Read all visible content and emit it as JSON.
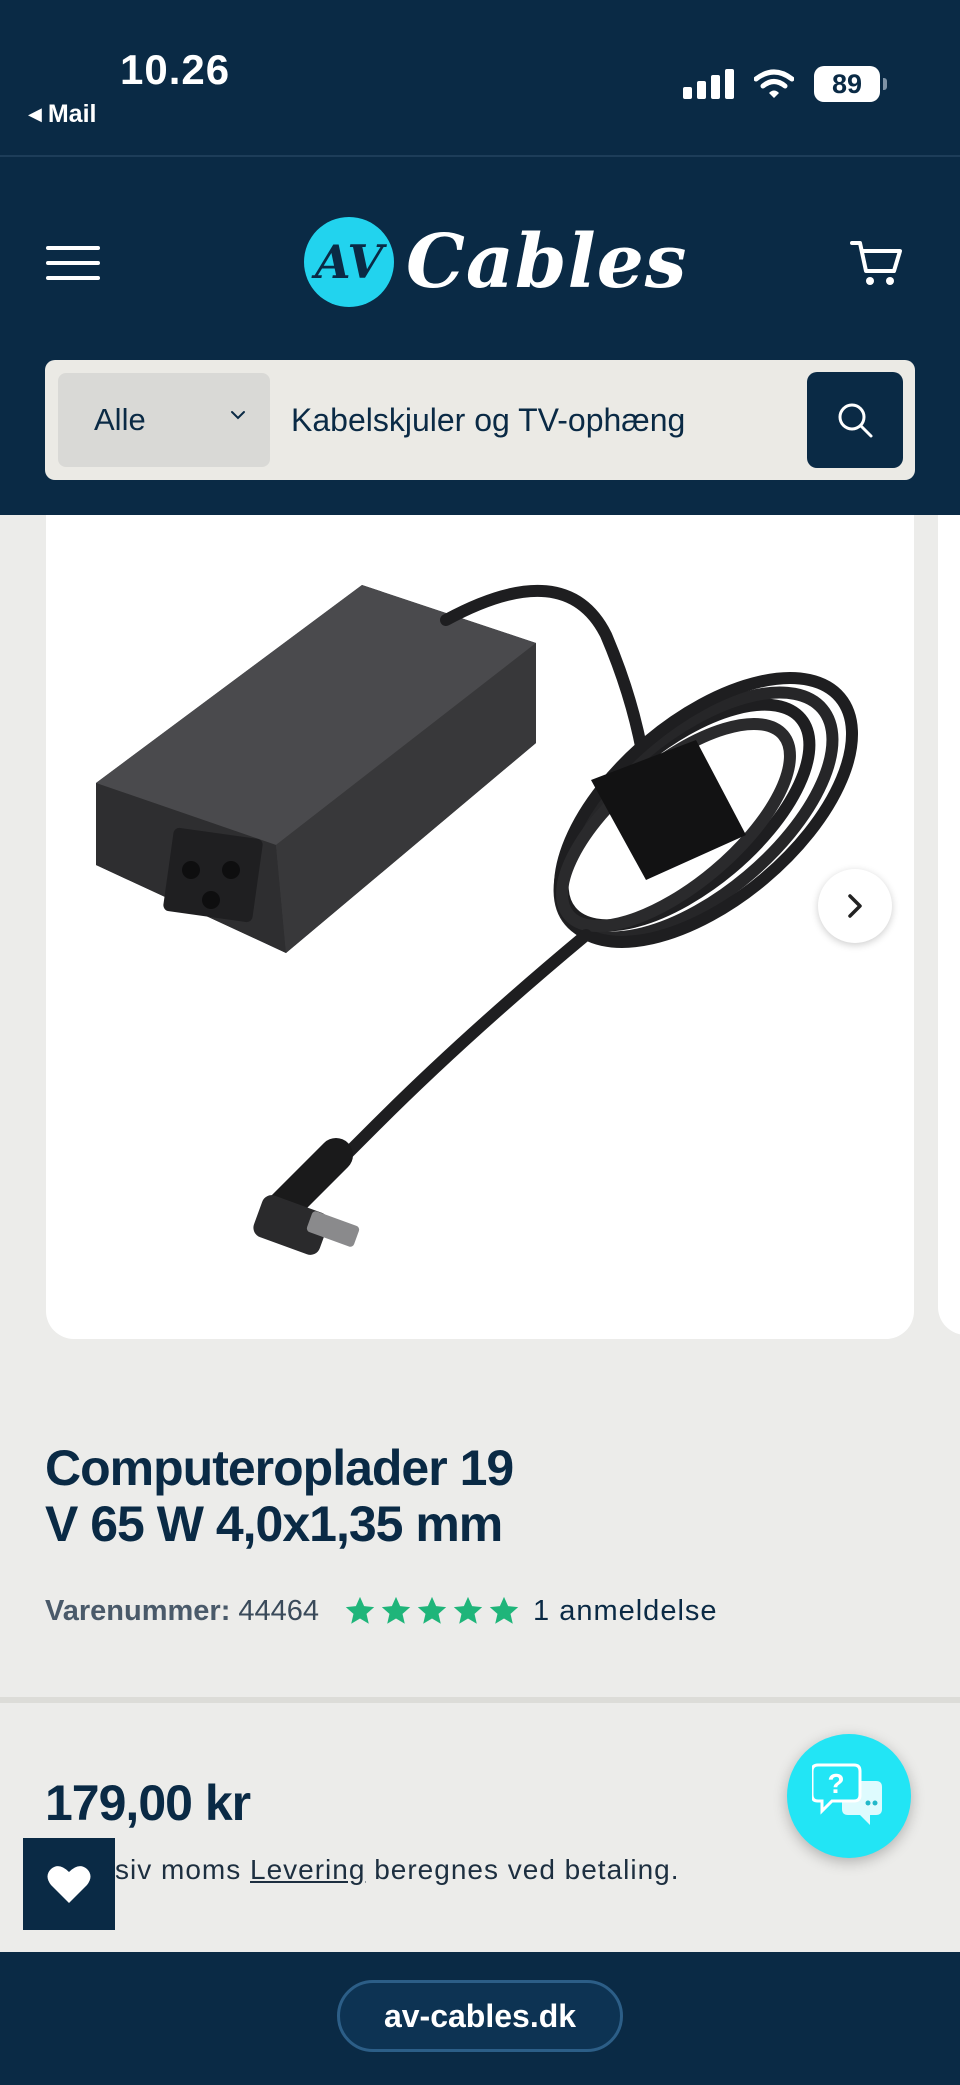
{
  "status_bar": {
    "time": "10.26",
    "back_label": "Mail",
    "battery": "89"
  },
  "header": {
    "logo_badge": "AV",
    "logo_word": "Cables"
  },
  "search": {
    "category": "Alle",
    "query": "Kabelskjuler og TV-ophæng"
  },
  "product": {
    "title_line1": "Computeroplader 19",
    "title_line2": "V 65 W 4,0x1,35 mm",
    "sku_label": "Varenummer:",
    "sku": "44464",
    "rating_stars": 5,
    "reviews": "1 anmeldelse",
    "price": "179,00 kr",
    "tax_prefix": "siv moms",
    "tax_link": "Levering",
    "tax_suffix": "beregnes ved betaling."
  },
  "browser": {
    "url": "av-cables.dk"
  },
  "colors": {
    "navy": "#0a2a45",
    "cyan": "#22d3ee",
    "star_green": "#1fb57a"
  }
}
